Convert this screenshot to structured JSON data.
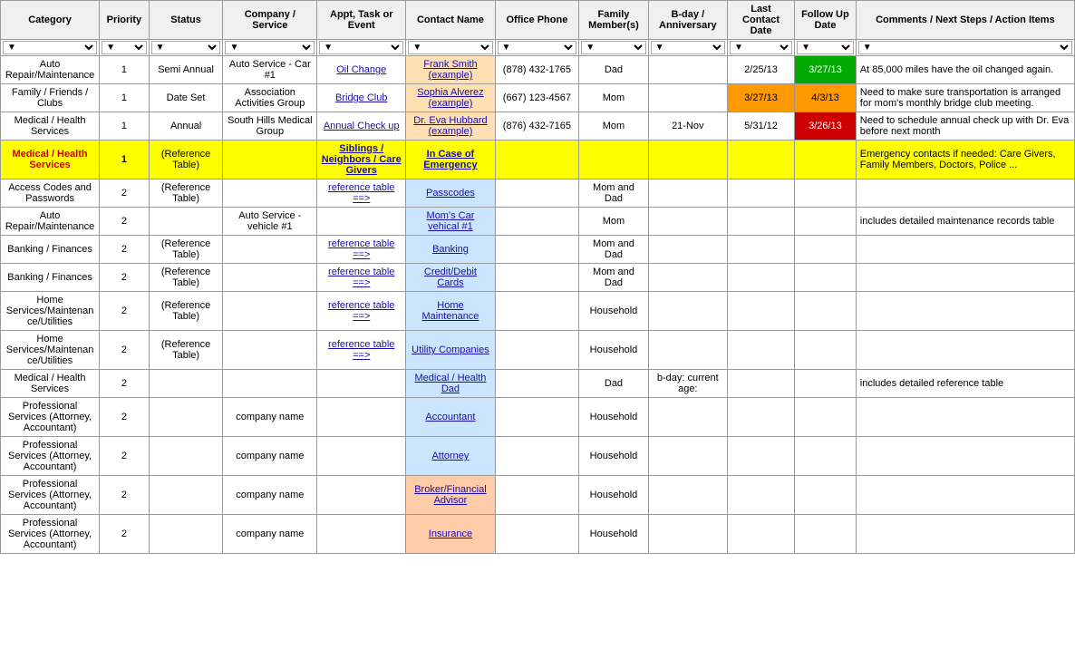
{
  "headers": [
    {
      "label": "Category",
      "col": "col-category"
    },
    {
      "label": "Priority",
      "col": "col-priority"
    },
    {
      "label": "Status",
      "col": "col-status"
    },
    {
      "label": "Company / Service",
      "col": "col-company"
    },
    {
      "label": "Appt, Task or Event",
      "col": "col-appt"
    },
    {
      "label": "Contact Name",
      "col": "col-contact"
    },
    {
      "label": "Office Phone",
      "col": "col-phone"
    },
    {
      "label": "Family Member(s)",
      "col": "col-family"
    },
    {
      "label": "B-day / Anniversary",
      "col": "col-bday"
    },
    {
      "label": "Last Contact Date",
      "col": "col-lastcontact"
    },
    {
      "label": "Follow Up Date",
      "col": "col-followup"
    },
    {
      "label": "Comments / Next Steps / Action Items",
      "col": "col-comments"
    }
  ],
  "rows": [
    {
      "category": "Auto Repair/Maintenance",
      "priority": "1",
      "status": "Semi Annual",
      "company": "Auto Service - Car #1",
      "appt": "Oil Change",
      "appt_link": true,
      "contact": "Frank Smith (example)",
      "contact_link": true,
      "contact_style": "light-orange-cell",
      "phone": "(878) 432-1765",
      "family": "Dad",
      "bday": "",
      "last_contact": "2/25/13",
      "follow_up": "3/27/13",
      "follow_up_style": "green-cell",
      "comments": "At 85,000 miles have the oil changed again."
    },
    {
      "category": "Family / Friends / Clubs",
      "priority": "1",
      "status": "Date Set",
      "company": "Association Activities Group",
      "appt": "Bridge Club",
      "appt_link": true,
      "contact": "Sophia Alverez (example)",
      "contact_link": true,
      "contact_style": "light-orange-cell",
      "phone": "(667) 123-4567",
      "family": "Mom",
      "bday": "",
      "last_contact": "3/27/13",
      "last_contact_style": "orange-cell",
      "follow_up": "4/3/13",
      "follow_up_style": "orange-cell",
      "comments": "Need to make sure transportation is arranged for mom's monthly bridge club meeting."
    },
    {
      "category": "Medical / Health Services",
      "priority": "1",
      "status": "Annual",
      "company": "South Hills Medical Group",
      "appt": "Annual Check up",
      "appt_link": true,
      "contact": "Dr. Eva Hubbard (example)",
      "contact_link": true,
      "contact_style": "light-orange-cell",
      "phone": "(876) 432-7165",
      "family": "Mom",
      "bday": "21-Nov",
      "last_contact": "5/31/12",
      "follow_up": "3/26/13",
      "follow_up_style": "red-cell",
      "comments": "Need to schedule annual check up with Dr. Eva before next month"
    },
    {
      "category": "Medical / Health Services",
      "priority": "1",
      "status": "(Reference Table)",
      "company": "",
      "appt": "Siblings / Neighbors / Care Givers",
      "appt_link": true,
      "contact": "In Case of Emergency",
      "contact_link": true,
      "contact_style": "",
      "phone": "",
      "family": "",
      "bday": "",
      "last_contact": "",
      "follow_up": "",
      "follow_up_style": "",
      "comments": "Emergency contacts if needed: Care Givers, Family Members, Doctors, Police ...",
      "row_style": "yellow-row"
    },
    {
      "category": "Access Codes and Passwords",
      "priority": "2",
      "status": "(Reference Table)",
      "company": "",
      "appt": "reference table ==>",
      "appt_link": true,
      "contact": "Passcodes",
      "contact_link": true,
      "contact_style": "light-blue-cell",
      "phone": "",
      "family": "Mom and Dad",
      "bday": "",
      "last_contact": "",
      "follow_up": "",
      "follow_up_style": "",
      "comments": ""
    },
    {
      "category": "Auto Repair/Maintenance",
      "priority": "2",
      "status": "",
      "company": "Auto Service - vehicle #1",
      "appt": "",
      "appt_link": false,
      "contact": "Mom's Car vehical #1",
      "contact_link": true,
      "contact_style": "light-blue-cell",
      "phone": "",
      "family": "Mom",
      "bday": "",
      "last_contact": "",
      "follow_up": "",
      "follow_up_style": "",
      "comments": "includes detailed maintenance records table"
    },
    {
      "category": "Banking / Finances",
      "priority": "2",
      "status": "(Reference Table)",
      "company": "",
      "appt": "reference table ==>",
      "appt_link": true,
      "contact": "Banking",
      "contact_link": true,
      "contact_style": "light-blue-cell",
      "phone": "",
      "family": "Mom and Dad",
      "bday": "",
      "last_contact": "",
      "follow_up": "",
      "follow_up_style": "",
      "comments": ""
    },
    {
      "category": "Banking / Finances",
      "priority": "2",
      "status": "(Reference Table)",
      "company": "",
      "appt": "reference table ==>",
      "appt_link": true,
      "contact": "Credit/Debit Cards",
      "contact_link": true,
      "contact_style": "light-blue-cell",
      "phone": "",
      "family": "Mom and Dad",
      "bday": "",
      "last_contact": "",
      "follow_up": "",
      "follow_up_style": "",
      "comments": ""
    },
    {
      "category": "Home Services/Maintenance/Utilities",
      "priority": "2",
      "status": "(Reference Table)",
      "company": "",
      "appt": "reference table ==>",
      "appt_link": true,
      "contact": "Home Maintenance",
      "contact_link": true,
      "contact_style": "light-blue-cell",
      "phone": "",
      "family": "Household",
      "bday": "",
      "last_contact": "",
      "follow_up": "",
      "follow_up_style": "",
      "comments": ""
    },
    {
      "category": "Home Services/Maintenance/Utilities",
      "priority": "2",
      "status": "(Reference Table)",
      "company": "",
      "appt": "reference table ==>",
      "appt_link": true,
      "contact": "Utility Companies",
      "contact_link": true,
      "contact_style": "light-blue-cell",
      "phone": "",
      "family": "Household",
      "bday": "",
      "last_contact": "",
      "follow_up": "",
      "follow_up_style": "",
      "comments": ""
    },
    {
      "category": "Medical / Health Services",
      "priority": "2",
      "status": "",
      "company": "",
      "appt": "",
      "appt_link": false,
      "contact": "Medical / Health Dad",
      "contact_link": true,
      "contact_style": "light-blue-cell",
      "phone": "",
      "family": "Dad",
      "bday": "b-day: current age:",
      "last_contact": "",
      "follow_up": "",
      "follow_up_style": "",
      "comments": "includes detailed reference table"
    },
    {
      "category": "Professional Services (Attorney, Accountant)",
      "priority": "2",
      "status": "",
      "company": "company name",
      "appt": "",
      "appt_link": false,
      "contact": "Accountant",
      "contact_link": true,
      "contact_style": "light-blue-cell",
      "phone": "",
      "family": "Household",
      "bday": "",
      "last_contact": "",
      "follow_up": "",
      "follow_up_style": "",
      "comments": ""
    },
    {
      "category": "Professional Services (Attorney, Accountant)",
      "priority": "2",
      "status": "",
      "company": "company name",
      "appt": "",
      "appt_link": false,
      "contact": "Attorney",
      "contact_link": true,
      "contact_style": "light-blue-cell",
      "phone": "",
      "family": "Household",
      "bday": "",
      "last_contact": "",
      "follow_up": "",
      "follow_up_style": "",
      "comments": ""
    },
    {
      "category": "Professional Services (Attorney, Accountant)",
      "priority": "2",
      "status": "",
      "company": "company name",
      "appt": "",
      "appt_link": false,
      "contact": "Broker/Financial Advisor",
      "contact_link": true,
      "contact_style": "peach-cell",
      "phone": "",
      "family": "Household",
      "bday": "",
      "last_contact": "",
      "follow_up": "",
      "follow_up_style": "",
      "comments": ""
    },
    {
      "category": "Professional Services (Attorney, Accountant)",
      "priority": "2",
      "status": "",
      "company": "company name",
      "appt": "",
      "appt_link": false,
      "contact": "Insurance",
      "contact_link": true,
      "contact_style": "peach-cell",
      "phone": "",
      "family": "Household",
      "bday": "",
      "last_contact": "",
      "follow_up": "",
      "follow_up_style": "",
      "comments": ""
    }
  ]
}
